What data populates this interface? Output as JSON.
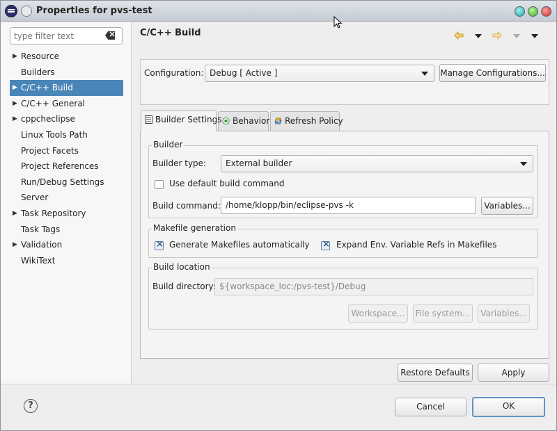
{
  "window": {
    "title": "Properties for pvs-test"
  },
  "filter": {
    "placeholder": "type filter text"
  },
  "tree": [
    {
      "label": "Resource",
      "expandable": true
    },
    {
      "label": "Builders",
      "expandable": false
    },
    {
      "label": "C/C++ Build",
      "expandable": true,
      "selected": true
    },
    {
      "label": "C/C++ General",
      "expandable": true
    },
    {
      "label": "cppcheclipse",
      "expandable": true
    },
    {
      "label": "Linux Tools Path",
      "expandable": false
    },
    {
      "label": "Project Facets",
      "expandable": false
    },
    {
      "label": "Project References",
      "expandable": false
    },
    {
      "label": "Run/Debug Settings",
      "expandable": false
    },
    {
      "label": "Server",
      "expandable": false
    },
    {
      "label": "Task Repository",
      "expandable": true
    },
    {
      "label": "Task Tags",
      "expandable": false
    },
    {
      "label": "Validation",
      "expandable": true
    },
    {
      "label": "WikiText",
      "expandable": false
    }
  ],
  "page": {
    "title": "C/C++ Build"
  },
  "configuration": {
    "label": "Configuration:",
    "value": "Debug  [ Active ]",
    "manage_label": "Manage Configurations..."
  },
  "tabs": [
    {
      "label": "Builder Settings",
      "active": true
    },
    {
      "label": "Behavior",
      "active": false
    },
    {
      "label": "Refresh Policy",
      "active": false
    }
  ],
  "builder": {
    "group_title": "Builder",
    "type_label": "Builder type:",
    "type_value": "External builder",
    "default_cmd_label": "Use default build command",
    "default_cmd_checked": false,
    "command_label": "Build command:",
    "command_value": "/home/klopp/bin/eclipse-pvs -k",
    "variables_label": "Variables..."
  },
  "makefile": {
    "group_title": "Makefile generation",
    "generate_label": "Generate Makefiles automatically",
    "generate_checked": true,
    "expand_label": "Expand Env. Variable Refs in Makefiles",
    "expand_checked": true
  },
  "location": {
    "group_title": "Build location",
    "dir_label": "Build directory:",
    "dir_value": "${workspace_loc:/pvs-test}/Debug",
    "workspace_label": "Workspace...",
    "filesystem_label": "File system...",
    "variables_label": "Variables..."
  },
  "actions": {
    "restore_label": "Restore Defaults",
    "apply_label": "Apply",
    "cancel_label": "Cancel",
    "ok_label": "OK"
  },
  "colors": {
    "selection": "#4a85b8",
    "focus": "#5b95cc"
  }
}
